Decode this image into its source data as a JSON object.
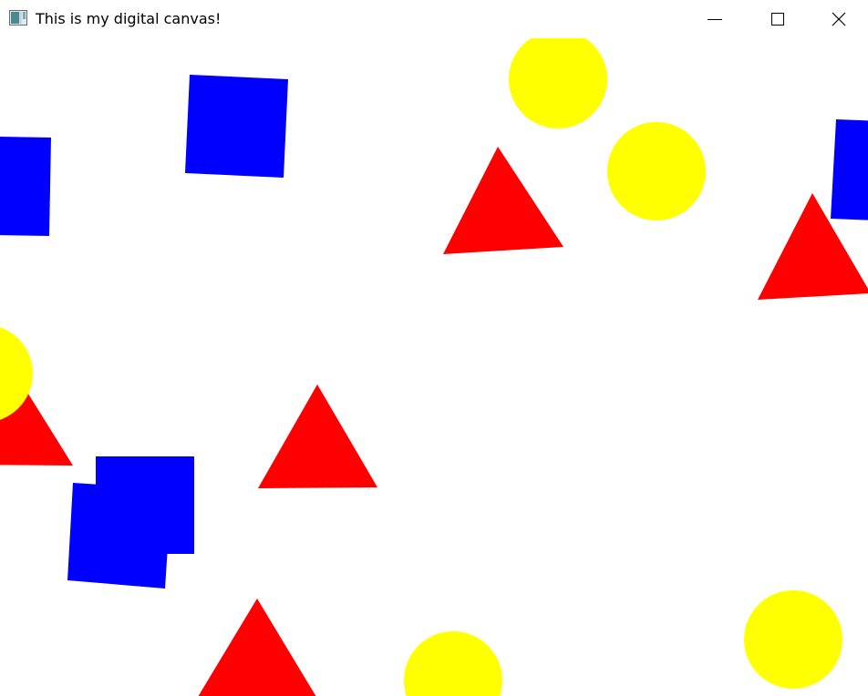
{
  "window": {
    "title": "This is my digital canvas!",
    "controls": {
      "minimize": "minimize",
      "maximize": "maximize",
      "close": "close"
    }
  },
  "icons": {
    "app": "app-window-icon",
    "minimize": "minimize-icon",
    "maximize": "maximize-icon",
    "close": "close-icon"
  },
  "colors": {
    "square": "#0000ff",
    "triangle": "#ff0000",
    "circle": "#ffff00",
    "background": "#ffffff"
  }
}
